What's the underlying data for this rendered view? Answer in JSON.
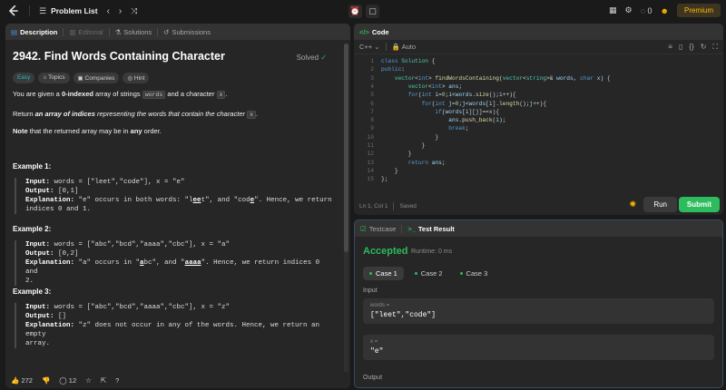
{
  "nav": {
    "title": "Problem List",
    "coins": "0",
    "premium": "Premium"
  },
  "desc_tabs": [
    {
      "label": "Description"
    },
    {
      "label": "Editorial"
    },
    {
      "label": "Solutions"
    },
    {
      "label": "Submissions"
    }
  ],
  "problem": {
    "title": "2942. Find Words Containing Character",
    "solved": "Solved",
    "badges": [
      "Easy",
      "Topics",
      "Companies",
      "Hint"
    ],
    "p1_a": "You are given a ",
    "p1_b": "0-indexed",
    "p1_c": " array of strings ",
    "p1_code1": "words",
    "p1_d": " and a character ",
    "p1_code2": "x",
    "p1_e": ".",
    "p2_a": "Return ",
    "p2_b": "an array of indices",
    "p2_c": " representing the words that contain the character ",
    "p2_code": "x",
    "p2_d": ".",
    "p3_a": "Note",
    "p3_b": " that the returned array may be in ",
    "p3_c": "any",
    "p3_d": " order."
  },
  "examples": [
    {
      "title": "Example 1:",
      "input_label": "Input:",
      "input": " words = [\"leet\",\"code\"], x = \"e\"",
      "output_label": "Output:",
      "output": " [0,1]",
      "expl_label": "Explanation:",
      "expl_1": " \"e\" occurs in both words: \"l",
      "expl_hl1": "ee",
      "expl_2": "t\", and \"cod",
      "expl_hl2": "e",
      "expl_3": "\". Hence, we return",
      "expl_4": "indices 0 and 1."
    },
    {
      "title": "Example 2:",
      "input_label": "Input:",
      "input": " words = [\"abc\",\"bcd\",\"aaaa\",\"cbc\"], x = \"a\"",
      "output_label": "Output:",
      "output": " [0,2]",
      "expl_label": "Explanation:",
      "expl_1": " \"a\" occurs in \"",
      "expl_hl1": "a",
      "expl_2": "bc\", and \"",
      "expl_hl2": "aaaa",
      "expl_3": "\". Hence, we return indices 0 and",
      "expl_4": "2."
    },
    {
      "title": "Example 3:",
      "input_label": "Input:",
      "input": " words = [\"abc\",\"bcd\",\"aaaa\",\"cbc\"], x = \"z\"",
      "output_label": "Output:",
      "output": " []",
      "expl_label": "Explanation:",
      "expl_1": " \"z\" does not occur in any of the words. Hence, we return an empty",
      "expl_4": "array."
    }
  ],
  "desc_footer": {
    "likes": "272",
    "comments": "12"
  },
  "code_panel": {
    "title": "Code",
    "language": "C++",
    "mode": "Auto",
    "cursor": "Ln 1, Col 1",
    "saved": "Saved",
    "run": "Run",
    "submit": "Submit"
  },
  "result_panel": {
    "tab_testcase": "Testcase",
    "tab_result": "Test Result",
    "status": "Accepted",
    "runtime": "Runtime: 0 ms",
    "cases": [
      "Case 1",
      "Case 2",
      "Case 3"
    ],
    "input_label": "Input",
    "var1_name": "words =",
    "var1_value": "[\"leet\",\"code\"]",
    "var2_name": "x =",
    "var2_value": "\"e\"",
    "output_label": "Output"
  },
  "colors": {
    "accent_green": "#2cbb5d",
    "easy": "#1cbaba",
    "premium": "#ffb800"
  }
}
